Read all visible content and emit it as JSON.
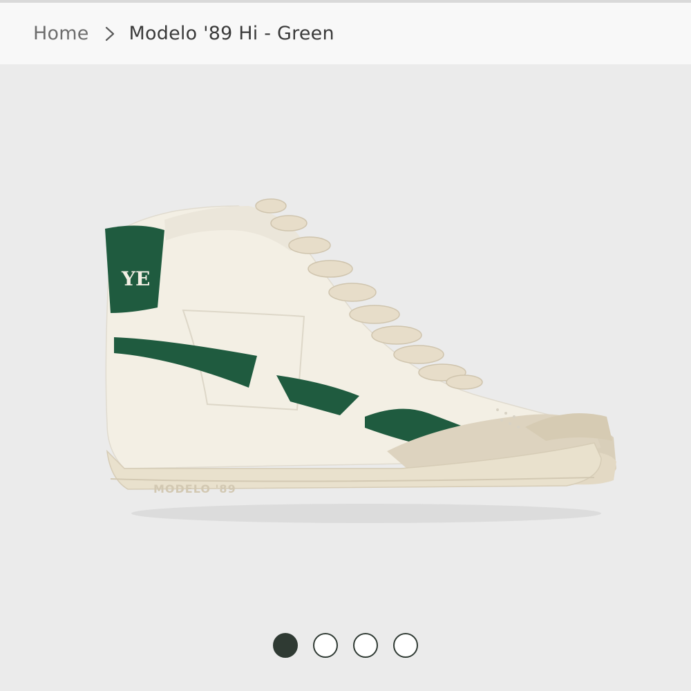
{
  "breadcrumb": {
    "home_label": "Home",
    "separator_icon": "chevron-right-icon",
    "current_label": "Modelo '89 Hi - Green"
  },
  "gallery": {
    "product_image": {
      "sole_text": "MODELO '89",
      "heel_logo_text": "YE"
    },
    "dots": [
      {
        "active": true
      },
      {
        "active": false
      },
      {
        "active": false
      },
      {
        "active": false
      }
    ],
    "current_index": 1,
    "total": 4
  },
  "colors": {
    "accent_green": "#1f5b3f",
    "shoe_body": "#f3efe4",
    "sole": "#e9e1cd",
    "suede": "#ddd3bf",
    "dot_active": "#2f3a33"
  }
}
